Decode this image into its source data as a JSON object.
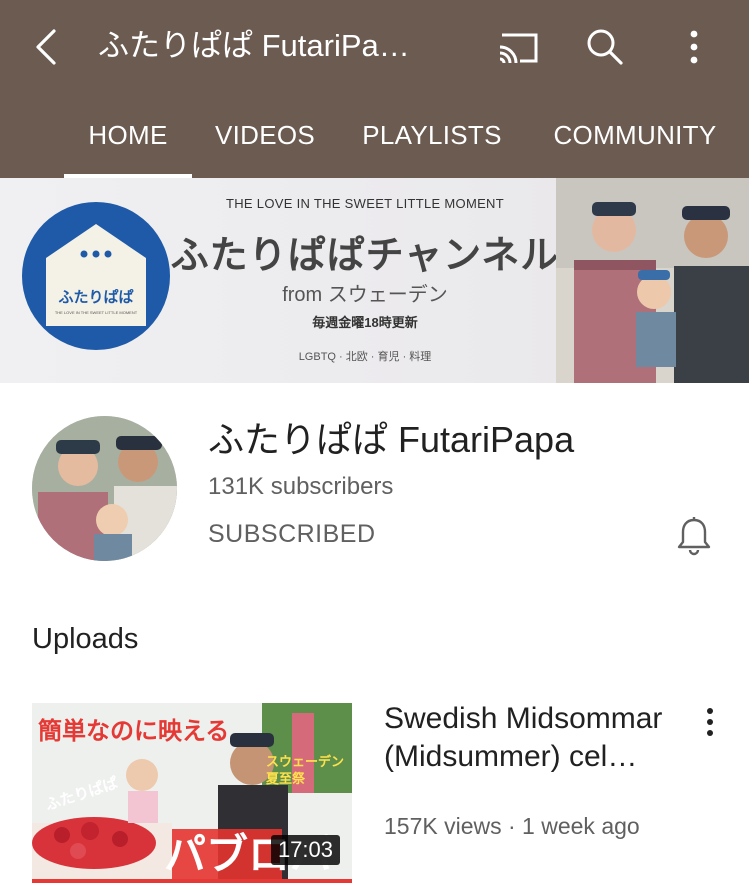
{
  "header": {
    "title": "ふたりぱぱ FutariPa…",
    "back_icon": "back-arrow-icon",
    "cast_icon": "cast-icon",
    "search_icon": "search-icon",
    "more_icon": "more-vert-icon",
    "background": "#6b5b51"
  },
  "tabs": [
    {
      "label": "HOME",
      "active": true
    },
    {
      "label": "VIDEOS",
      "active": false
    },
    {
      "label": "PLAYLISTS",
      "active": false
    },
    {
      "label": "COMMUNITY",
      "active": false
    }
  ],
  "banner": {
    "tagline": "THE LOVE IN THE SWEET LITTLE MOMENT",
    "channel_jp": "ふたりぱぱチャンネル",
    "from": "from スウェーデン",
    "schedule": "毎週金曜18時更新",
    "topics": "LGBTQ · 北欧 · 育児 · 料理",
    "logo_text": "ふたりぱぱ",
    "logo_subtext": "THE LOVE IN THE SWEET LITTLE MOMENT"
  },
  "channel": {
    "name": "ふたりぱぱ FutariPapa",
    "subscribers": "131K subscribers",
    "subscribe_state": "SUBSCRIBED",
    "bell_icon": "bell-icon"
  },
  "uploads": {
    "heading": "Uploads",
    "videos": [
      {
        "title": "Swedish Midsommar (Midsummer) cel…",
        "meta": "157K views · 1 week ago",
        "duration": "17:03",
        "thumb_text_top": "簡単なのに映える",
        "thumb_text_side": "スウェーデン夏至祭",
        "thumb_text_curve": "ふたりぱぱ",
        "thumb_text_big": "パブロバ"
      }
    ]
  }
}
